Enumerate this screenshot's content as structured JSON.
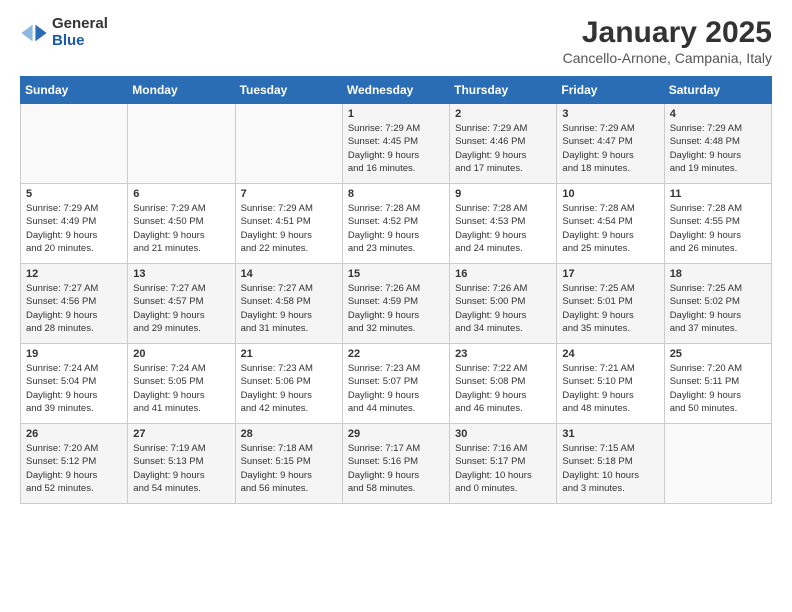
{
  "logo": {
    "general": "General",
    "blue": "Blue"
  },
  "header": {
    "title": "January 2025",
    "subtitle": "Cancello-Arnone, Campania, Italy"
  },
  "weekdays": [
    "Sunday",
    "Monday",
    "Tuesday",
    "Wednesday",
    "Thursday",
    "Friday",
    "Saturday"
  ],
  "weeks": [
    [
      {
        "day": "",
        "info": ""
      },
      {
        "day": "",
        "info": ""
      },
      {
        "day": "",
        "info": ""
      },
      {
        "day": "1",
        "info": "Sunrise: 7:29 AM\nSunset: 4:45 PM\nDaylight: 9 hours\nand 16 minutes."
      },
      {
        "day": "2",
        "info": "Sunrise: 7:29 AM\nSunset: 4:46 PM\nDaylight: 9 hours\nand 17 minutes."
      },
      {
        "day": "3",
        "info": "Sunrise: 7:29 AM\nSunset: 4:47 PM\nDaylight: 9 hours\nand 18 minutes."
      },
      {
        "day": "4",
        "info": "Sunrise: 7:29 AM\nSunset: 4:48 PM\nDaylight: 9 hours\nand 19 minutes."
      }
    ],
    [
      {
        "day": "5",
        "info": "Sunrise: 7:29 AM\nSunset: 4:49 PM\nDaylight: 9 hours\nand 20 minutes."
      },
      {
        "day": "6",
        "info": "Sunrise: 7:29 AM\nSunset: 4:50 PM\nDaylight: 9 hours\nand 21 minutes."
      },
      {
        "day": "7",
        "info": "Sunrise: 7:29 AM\nSunset: 4:51 PM\nDaylight: 9 hours\nand 22 minutes."
      },
      {
        "day": "8",
        "info": "Sunrise: 7:28 AM\nSunset: 4:52 PM\nDaylight: 9 hours\nand 23 minutes."
      },
      {
        "day": "9",
        "info": "Sunrise: 7:28 AM\nSunset: 4:53 PM\nDaylight: 9 hours\nand 24 minutes."
      },
      {
        "day": "10",
        "info": "Sunrise: 7:28 AM\nSunset: 4:54 PM\nDaylight: 9 hours\nand 25 minutes."
      },
      {
        "day": "11",
        "info": "Sunrise: 7:28 AM\nSunset: 4:55 PM\nDaylight: 9 hours\nand 26 minutes."
      }
    ],
    [
      {
        "day": "12",
        "info": "Sunrise: 7:27 AM\nSunset: 4:56 PM\nDaylight: 9 hours\nand 28 minutes."
      },
      {
        "day": "13",
        "info": "Sunrise: 7:27 AM\nSunset: 4:57 PM\nDaylight: 9 hours\nand 29 minutes."
      },
      {
        "day": "14",
        "info": "Sunrise: 7:27 AM\nSunset: 4:58 PM\nDaylight: 9 hours\nand 31 minutes."
      },
      {
        "day": "15",
        "info": "Sunrise: 7:26 AM\nSunset: 4:59 PM\nDaylight: 9 hours\nand 32 minutes."
      },
      {
        "day": "16",
        "info": "Sunrise: 7:26 AM\nSunset: 5:00 PM\nDaylight: 9 hours\nand 34 minutes."
      },
      {
        "day": "17",
        "info": "Sunrise: 7:25 AM\nSunset: 5:01 PM\nDaylight: 9 hours\nand 35 minutes."
      },
      {
        "day": "18",
        "info": "Sunrise: 7:25 AM\nSunset: 5:02 PM\nDaylight: 9 hours\nand 37 minutes."
      }
    ],
    [
      {
        "day": "19",
        "info": "Sunrise: 7:24 AM\nSunset: 5:04 PM\nDaylight: 9 hours\nand 39 minutes."
      },
      {
        "day": "20",
        "info": "Sunrise: 7:24 AM\nSunset: 5:05 PM\nDaylight: 9 hours\nand 41 minutes."
      },
      {
        "day": "21",
        "info": "Sunrise: 7:23 AM\nSunset: 5:06 PM\nDaylight: 9 hours\nand 42 minutes."
      },
      {
        "day": "22",
        "info": "Sunrise: 7:23 AM\nSunset: 5:07 PM\nDaylight: 9 hours\nand 44 minutes."
      },
      {
        "day": "23",
        "info": "Sunrise: 7:22 AM\nSunset: 5:08 PM\nDaylight: 9 hours\nand 46 minutes."
      },
      {
        "day": "24",
        "info": "Sunrise: 7:21 AM\nSunset: 5:10 PM\nDaylight: 9 hours\nand 48 minutes."
      },
      {
        "day": "25",
        "info": "Sunrise: 7:20 AM\nSunset: 5:11 PM\nDaylight: 9 hours\nand 50 minutes."
      }
    ],
    [
      {
        "day": "26",
        "info": "Sunrise: 7:20 AM\nSunset: 5:12 PM\nDaylight: 9 hours\nand 52 minutes."
      },
      {
        "day": "27",
        "info": "Sunrise: 7:19 AM\nSunset: 5:13 PM\nDaylight: 9 hours\nand 54 minutes."
      },
      {
        "day": "28",
        "info": "Sunrise: 7:18 AM\nSunset: 5:15 PM\nDaylight: 9 hours\nand 56 minutes."
      },
      {
        "day": "29",
        "info": "Sunrise: 7:17 AM\nSunset: 5:16 PM\nDaylight: 9 hours\nand 58 minutes."
      },
      {
        "day": "30",
        "info": "Sunrise: 7:16 AM\nSunset: 5:17 PM\nDaylight: 10 hours\nand 0 minutes."
      },
      {
        "day": "31",
        "info": "Sunrise: 7:15 AM\nSunset: 5:18 PM\nDaylight: 10 hours\nand 3 minutes."
      },
      {
        "day": "",
        "info": ""
      }
    ]
  ]
}
